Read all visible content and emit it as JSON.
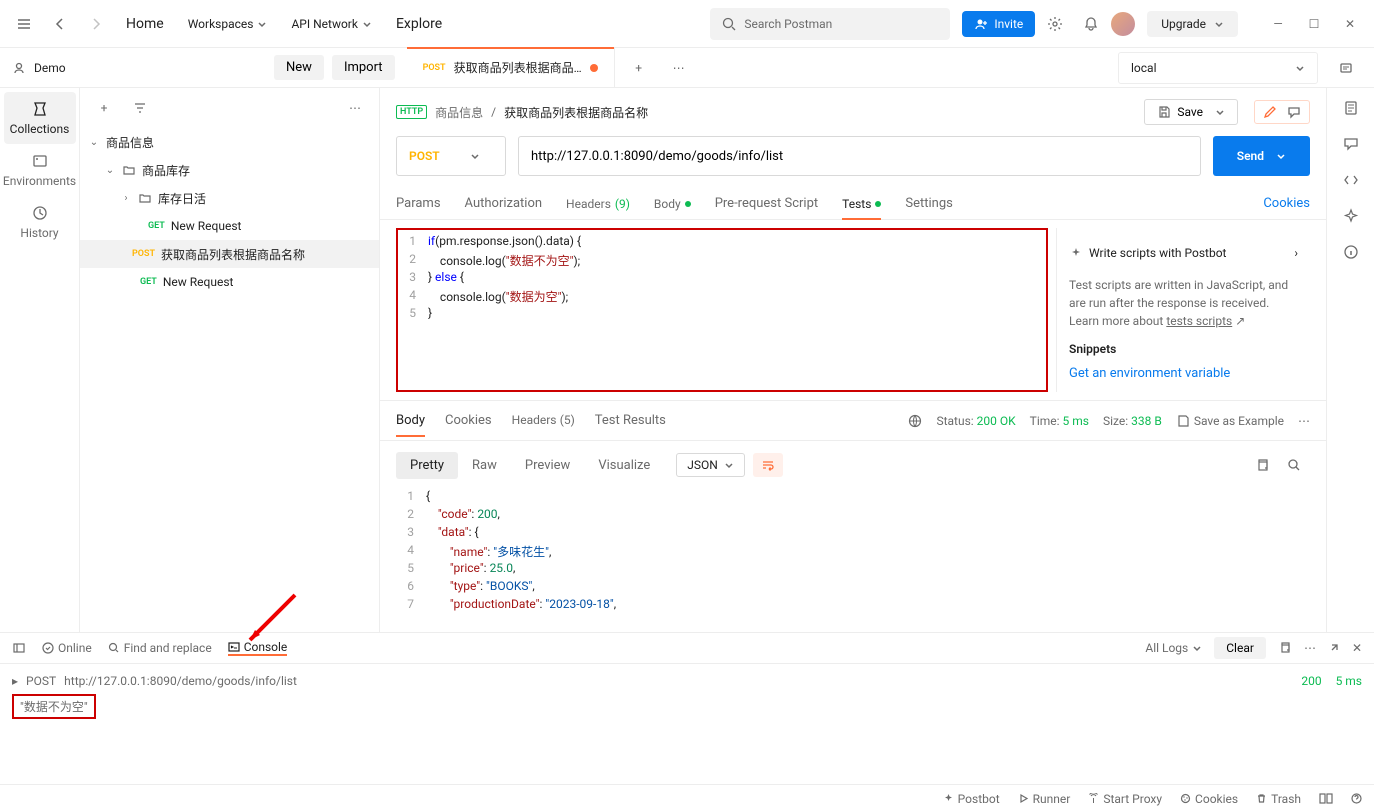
{
  "top": {
    "home": "Home",
    "workspaces": "Workspaces",
    "api_network": "API Network",
    "explore": "Explore",
    "search_placeholder": "Search Postman",
    "invite": "Invite",
    "upgrade": "Upgrade"
  },
  "workspace": {
    "name": "Demo",
    "new_btn": "New",
    "import_btn": "Import"
  },
  "rail": {
    "collections": "Collections",
    "environments": "Environments",
    "history": "History"
  },
  "tree": {
    "root": "商品信息",
    "folder1": "商品库存",
    "folder2": "库存日活",
    "req1_method": "GET",
    "req1_name": "New Request",
    "req2_method": "POST",
    "req2_name": "获取商品列表根据商品名称",
    "req3_method": "GET",
    "req3_name": "New Request"
  },
  "tab": {
    "method": "POST",
    "title": "获取商品列表根据商品…"
  },
  "env": "local",
  "breadcrumb": {
    "folder": "商品信息",
    "name": "获取商品列表根据商品名称",
    "save": "Save"
  },
  "request": {
    "method": "POST",
    "url": "http://127.0.0.1:8090/demo/goods/info/list",
    "send": "Send"
  },
  "req_tabs": {
    "params": "Params",
    "auth": "Authorization",
    "headers": "Headers",
    "headers_count": "(9)",
    "body": "Body",
    "prereq": "Pre-request Script",
    "tests": "Tests",
    "settings": "Settings",
    "cookies": "Cookies"
  },
  "code": {
    "l1a": "if",
    "l1b": "(pm.response.json().data) {",
    "l2a": "    console.log(",
    "l2b": "\"数据不为空\"",
    "l2c": ");",
    "l3a": "} ",
    "l3b": "else",
    "l3c": " {",
    "l4a": "    console.log(",
    "l4b": "\"数据为空\"",
    "l4c": ");",
    "l5": "}"
  },
  "sidepanel": {
    "postbot": "Write scripts with Postbot",
    "desc": "Test scripts are written in JavaScript, and are run after the response is received. Learn more about ",
    "link": "tests scripts",
    "snippets": "Snippets",
    "snippet1": "Get an environment variable"
  },
  "resp_tabs": {
    "body": "Body",
    "cookies": "Cookies",
    "headers": "Headers",
    "headers_count": "(5)",
    "test_results": "Test Results"
  },
  "resp_meta": {
    "status_lbl": "Status:",
    "status_val": "200 OK",
    "time_lbl": "Time:",
    "time_val": "5 ms",
    "size_lbl": "Size:",
    "size_val": "338 B",
    "save_example": "Save as Example"
  },
  "view": {
    "pretty": "Pretty",
    "raw": "Raw",
    "preview": "Preview",
    "visualize": "Visualize",
    "format": "JSON"
  },
  "json": {
    "l1": "{",
    "l2k": "\"code\"",
    "l2v": "200",
    "l3k": "\"data\"",
    "l3v": "{",
    "l4k": "\"name\"",
    "l4v": "\"多味花生\"",
    "l5k": "\"price\"",
    "l5v": "25.0",
    "l6k": "\"type\"",
    "l6v": "\"BOOKS\"",
    "l7k": "\"productionDate\"",
    "l7v": "\"2023-09-18\""
  },
  "footer": {
    "online": "Online",
    "find": "Find and replace",
    "console": "Console",
    "all_logs": "All Logs",
    "clear": "Clear"
  },
  "console": {
    "method": "POST",
    "url": "http://127.0.0.1:8090/demo/goods/info/list",
    "status": "200",
    "time": "5 ms",
    "output": "\"数据不为空\""
  },
  "status": {
    "postbot": "Postbot",
    "runner": "Runner",
    "proxy": "Start Proxy",
    "cookies": "Cookies",
    "trash": "Trash"
  }
}
